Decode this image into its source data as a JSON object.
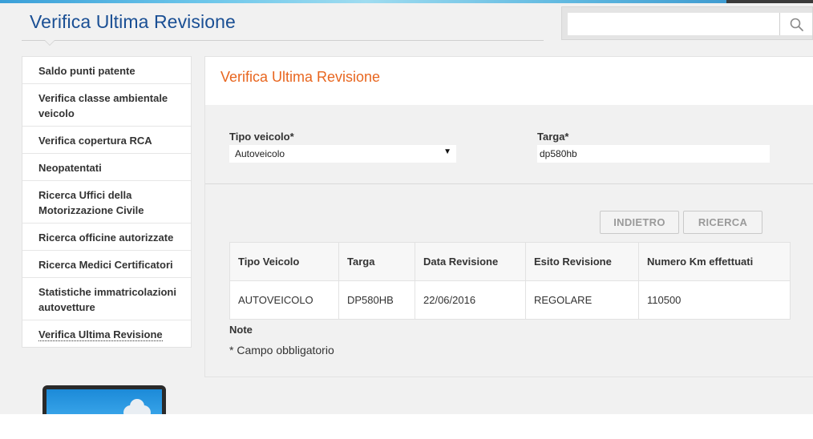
{
  "header": {
    "page_title": "Verifica Ultima Revisione",
    "search_placeholder": "",
    "search_icon": "search-icon"
  },
  "sidebar": {
    "items": [
      {
        "label": "Saldo punti patente"
      },
      {
        "label": "Verifica classe ambientale veicolo"
      },
      {
        "label": "Verifica copertura RCA"
      },
      {
        "label": "Neopatentati"
      },
      {
        "label": "Ricerca Uffici della Motorizzazione Civile"
      },
      {
        "label": "Ricerca officine autorizzate"
      },
      {
        "label": "Ricerca Medici Certificatori"
      },
      {
        "label": "Statistiche immatricolazioni autovetture"
      },
      {
        "label": "Verifica Ultima Revisione"
      }
    ]
  },
  "main": {
    "title": "Verifica Ultima Revisione",
    "form": {
      "vehicle_type_label": "Tipo veicolo*",
      "vehicle_type_value": "Autoveicolo",
      "plate_label": "Targa*",
      "plate_value": "dp580hb"
    },
    "buttons": {
      "back_label": "INDIETRO",
      "search_label": "RICERCA"
    },
    "table": {
      "columns": [
        "Tipo Veicolo",
        "Targa",
        "Data Revisione",
        "Esito Revisione",
        "Numero Km effettuati"
      ],
      "rows": [
        [
          "AUTOVEICOLO",
          "DP580HB",
          "22/06/2016",
          "REGOLARE",
          "110500"
        ]
      ]
    },
    "notes": {
      "title": "Note",
      "text": "* Campo obbligatorio"
    }
  },
  "colors": {
    "page_title": "#1a4f94",
    "section_title": "#e8661f",
    "background": "#f1f1f1"
  }
}
